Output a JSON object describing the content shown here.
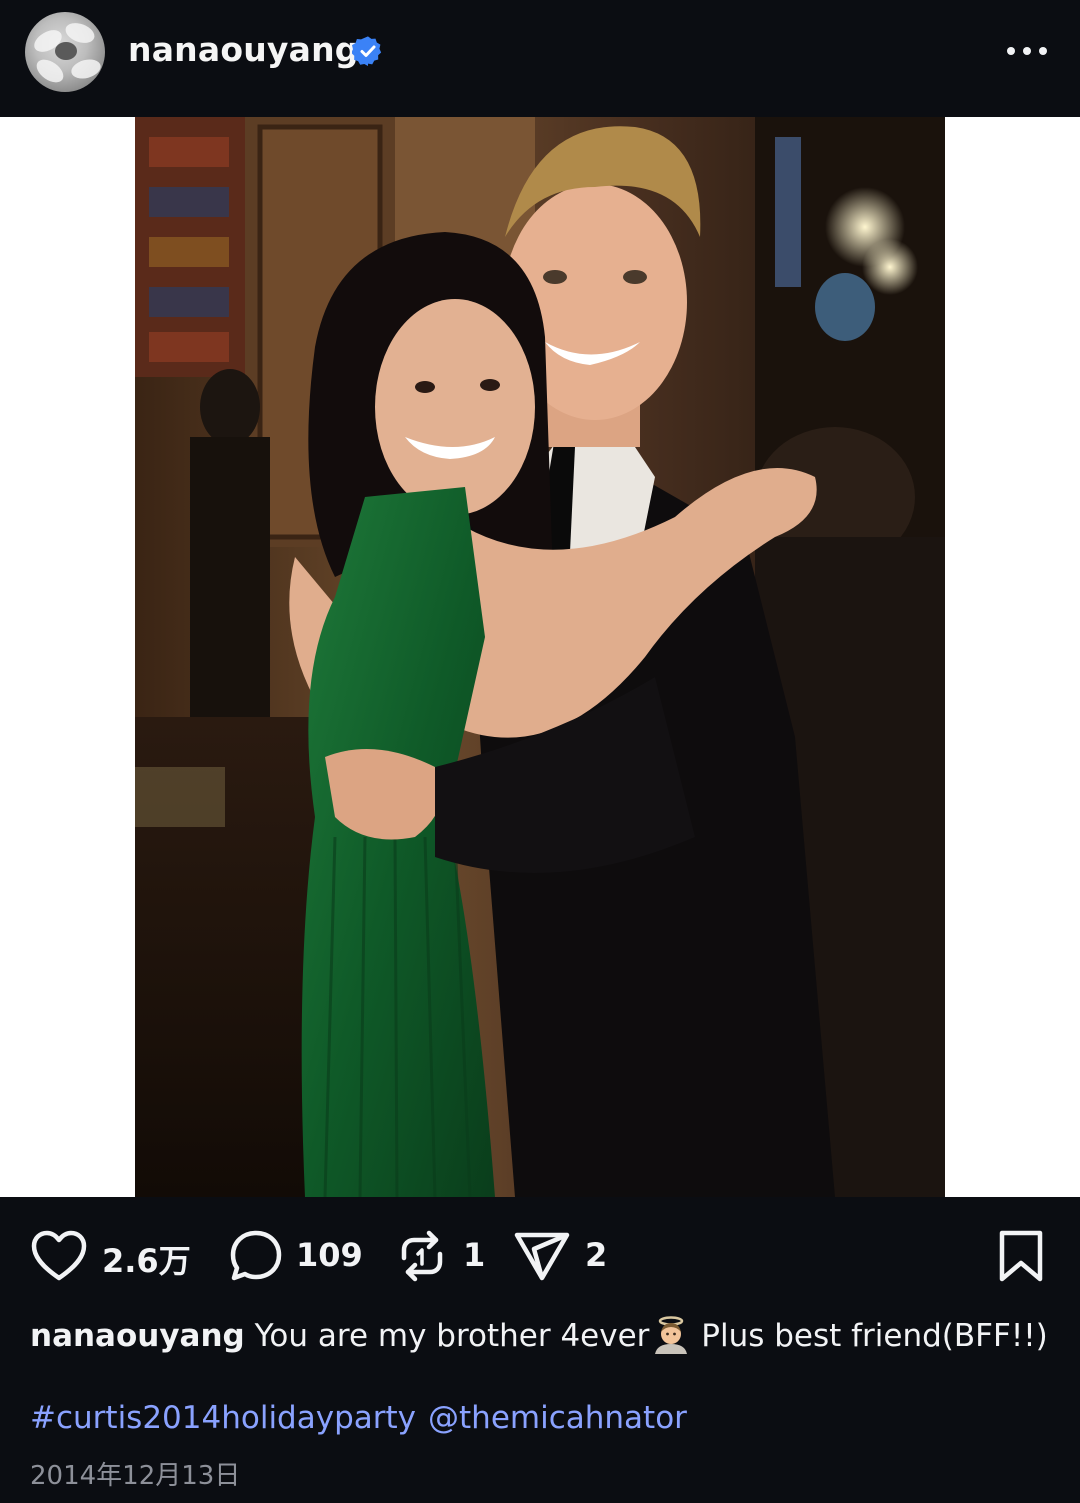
{
  "post": {
    "username": "nanaouyang",
    "verified": true
  },
  "metrics": {
    "likes": "2.6万",
    "comments": "109",
    "reposts": "1",
    "shares": "2"
  },
  "caption": {
    "username": "nanaouyang",
    "text_before_emoji": "You are my brother 4ever",
    "emoji": "man-with-halo-emoji",
    "text_after_emoji": " Plus best friend(BFF!!)",
    "hashtag": "#curtis2014holidayparty",
    "mention": "@themicahnator"
  },
  "date": "2014年12月13日",
  "icons": {
    "more": "more-horizontal-icon",
    "like": "heart-icon",
    "comment": "comment-icon",
    "repost": "repost-icon",
    "share": "send-icon",
    "save": "bookmark-icon"
  },
  "colors": {
    "background": "#0b0d12",
    "verified": "#3b82f6",
    "link": "#8aa2ff",
    "date": "#8d9099"
  }
}
